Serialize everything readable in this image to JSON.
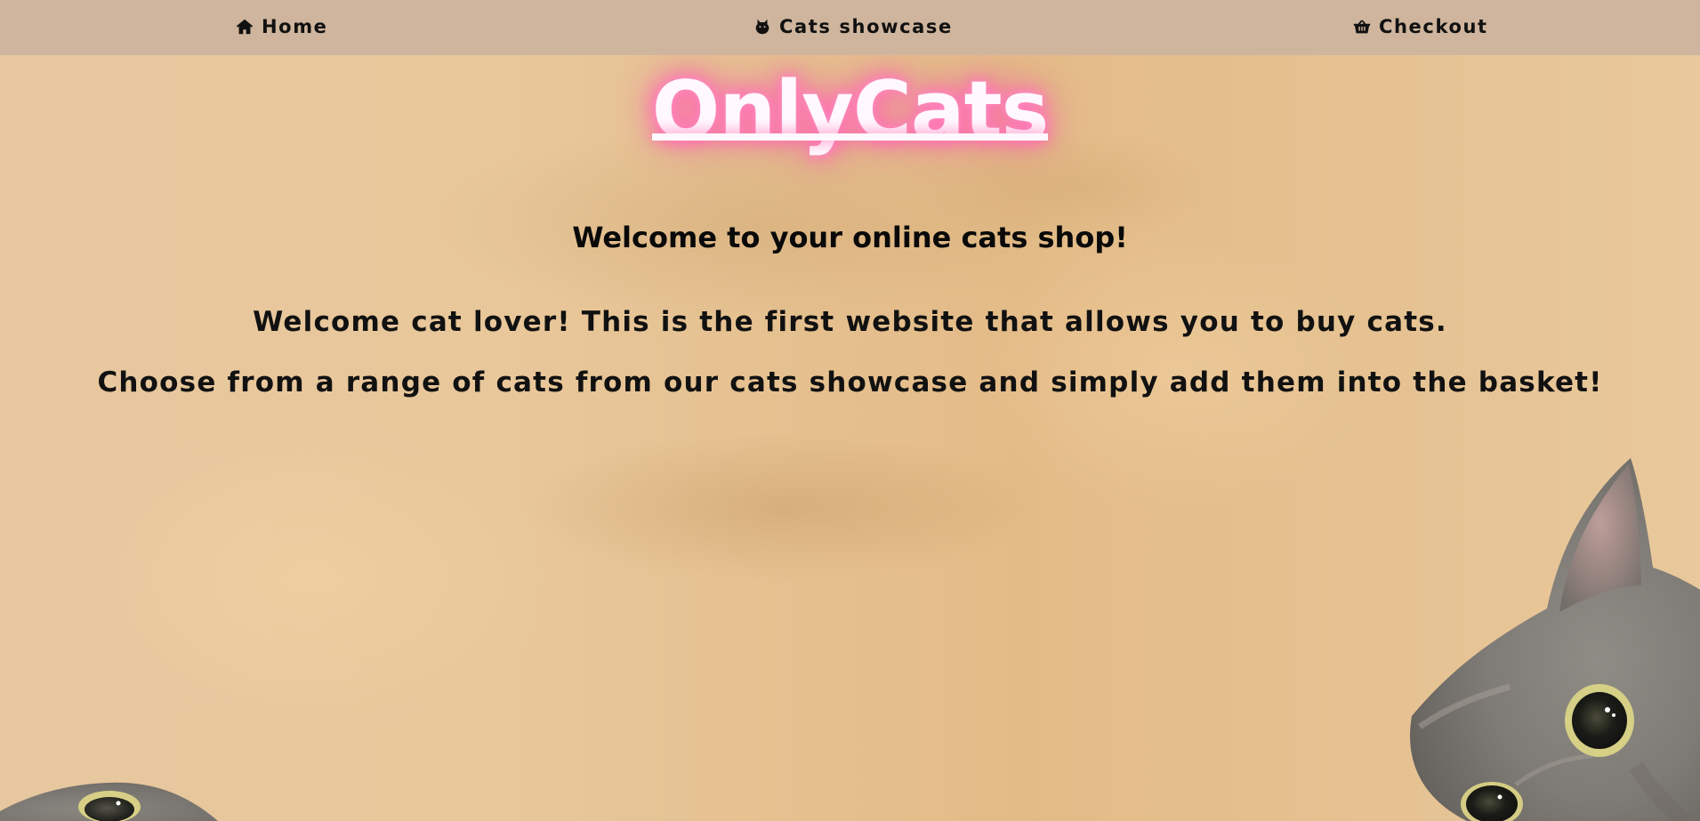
{
  "nav": {
    "home": "Home",
    "showcase": "Cats showcase",
    "checkout": "Checkout"
  },
  "hero": {
    "brand": "OnlyCats",
    "tagline": "Welcome to your online cats shop!"
  },
  "intro": {
    "line1": "Welcome cat lover! This is the first website that allows you to buy cats.",
    "line2": "Choose from a range of cats from our cats showcase and simply add them into the basket!"
  },
  "colors": {
    "nav_bg": "#cfb59d",
    "page_bg": "#e8c79a",
    "brand_glow": "#ff6aae"
  },
  "icons": {
    "home": "home-icon",
    "showcase": "cat-icon",
    "checkout": "basket-icon"
  }
}
